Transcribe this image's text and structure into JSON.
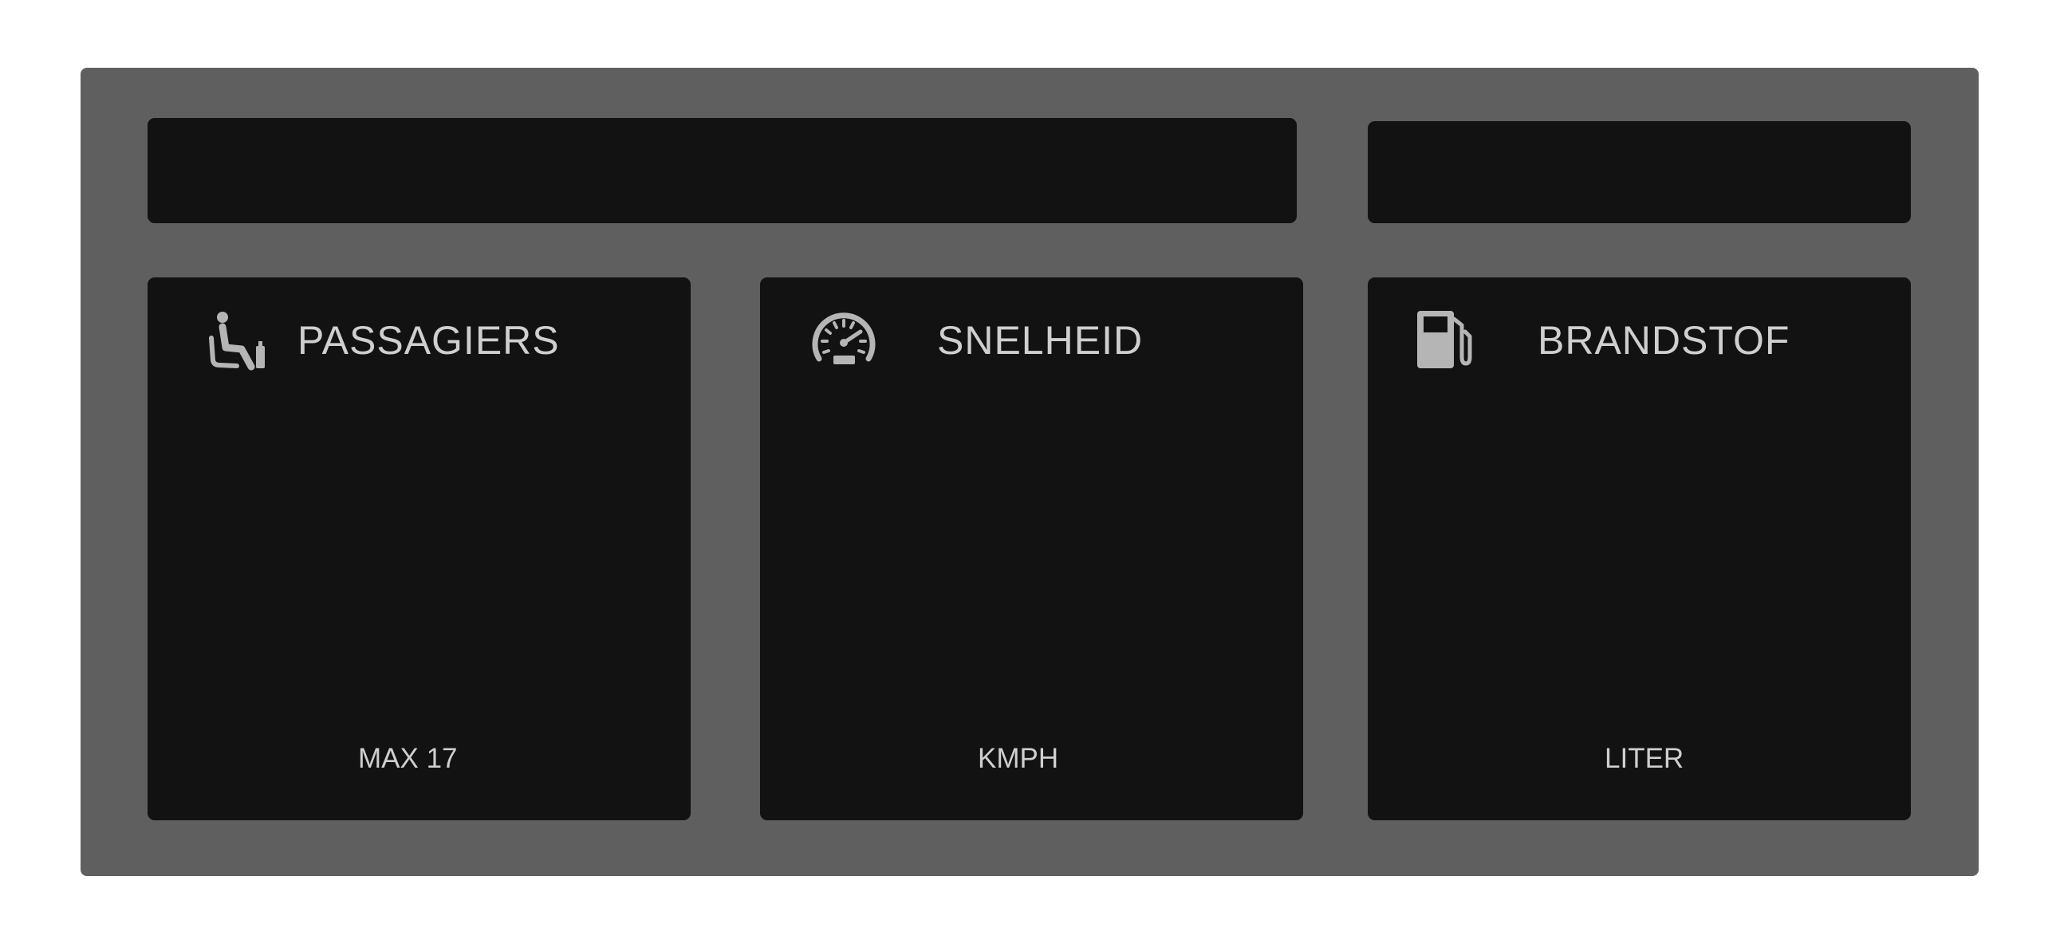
{
  "dashboard": {
    "cards": [
      {
        "title": "PASSAGIERS",
        "unit": "MAX 17",
        "icon": "seat-icon"
      },
      {
        "title": "SNELHEID",
        "unit": "KMPH",
        "icon": "speedometer-icon"
      },
      {
        "title": "BRANDSTOF",
        "unit": "LITER",
        "icon": "fuel-pump-icon"
      }
    ]
  },
  "colors": {
    "frame": "#5f5f5f",
    "panel": "#121212",
    "text": "#cfcfcf",
    "icon": "#b5b5b5"
  }
}
